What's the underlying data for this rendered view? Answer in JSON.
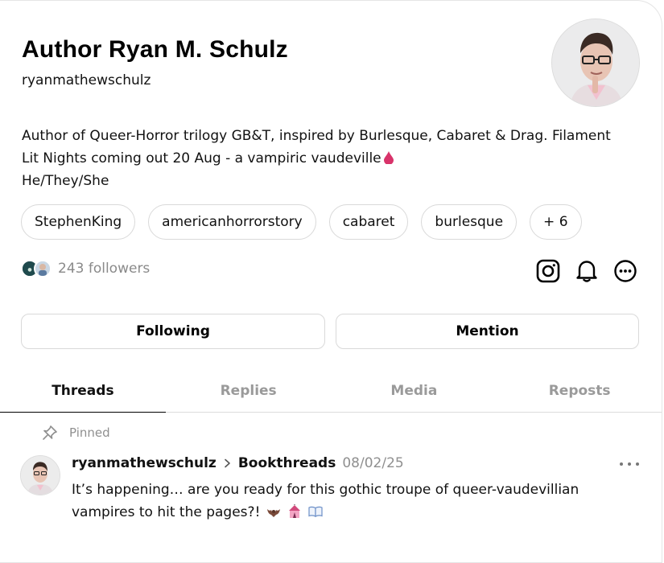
{
  "profile": {
    "display_name": "Author Ryan M. Schulz",
    "handle": "ryanmathewschulz",
    "bio_line1": "Author of Queer-Horror trilogy GB&T, inspired by Burlesque, Cabaret & Drag. Filament",
    "bio_line2": "Lit Nights coming out 20 Aug - a vampiric vaudeville",
    "bio_line3": "He/They/She",
    "followers_text": "243 followers",
    "avatar_icon": "profile-photo"
  },
  "tags": [
    {
      "label": "StephenKing"
    },
    {
      "label": "americanhorrorstory"
    },
    {
      "label": "cabaret"
    },
    {
      "label": "burlesque"
    },
    {
      "label": "+ 6"
    }
  ],
  "actions": {
    "following_label": "Following",
    "mention_label": "Mention",
    "icons": [
      "instagram-icon",
      "bell-icon",
      "more-circle-icon"
    ]
  },
  "tabs": [
    {
      "label": "Threads",
      "active": true
    },
    {
      "label": "Replies",
      "active": false
    },
    {
      "label": "Media",
      "active": false
    },
    {
      "label": "Reposts",
      "active": false
    }
  ],
  "post": {
    "pinned_label": "Pinned",
    "username": "ryanmathewschulz",
    "topic": "Bookthreads",
    "date": "08/02/25",
    "text_line1": "It’s happening… are you ready for this gothic troupe of queer-vaudevillian",
    "text_line2": "vampires to hit the pages?!",
    "emojis": [
      "bat-emoji",
      "circus-tent-emoji",
      "open-book-emoji"
    ]
  },
  "colors": {
    "muted_text": "#8a8a8a",
    "border": "#d9d9d9",
    "drop_red": "#d8336a"
  }
}
